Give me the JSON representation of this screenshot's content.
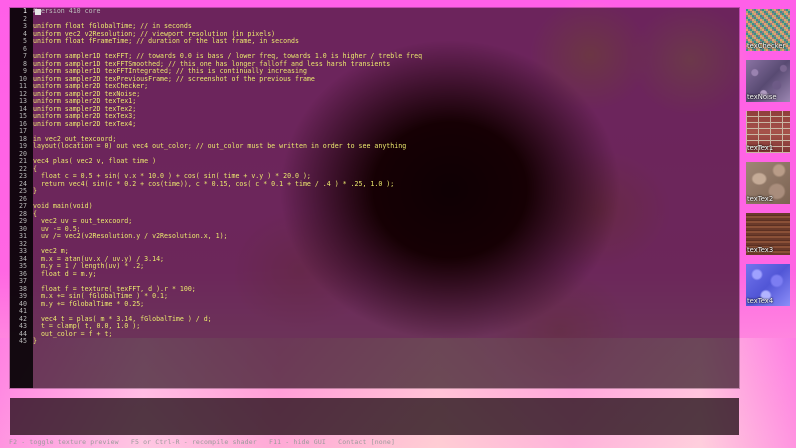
{
  "editor": {
    "lines": [
      {
        "num": "1",
        "text": "#version 410 core"
      },
      {
        "num": "2",
        "text": ""
      },
      {
        "num": "3",
        "text": "uniform float fGlobalTime; // in seconds"
      },
      {
        "num": "4",
        "text": "uniform vec2 v2Resolution; // viewport resolution (in pixels)"
      },
      {
        "num": "5",
        "text": "uniform float fFrameTime; // duration of the last frame, in seconds"
      },
      {
        "num": "6",
        "text": ""
      },
      {
        "num": "7",
        "text": "uniform sampler1D texFFT; // towards 0.0 is bass / lower freq, towards 1.0 is higher / treble freq"
      },
      {
        "num": "8",
        "text": "uniform sampler1D texFFTSmoothed; // this one has longer falloff and less harsh transients"
      },
      {
        "num": "9",
        "text": "uniform sampler1D texFFTIntegrated; // this is continually increasing"
      },
      {
        "num": "10",
        "text": "uniform sampler2D texPreviousFrame; // screenshot of the previous frame"
      },
      {
        "num": "11",
        "text": "uniform sampler2D texChecker;"
      },
      {
        "num": "12",
        "text": "uniform sampler2D texNoise;"
      },
      {
        "num": "13",
        "text": "uniform sampler2D texTex1;"
      },
      {
        "num": "14",
        "text": "uniform sampler2D texTex2;"
      },
      {
        "num": "15",
        "text": "uniform sampler2D texTex3;"
      },
      {
        "num": "16",
        "text": "uniform sampler2D texTex4;"
      },
      {
        "num": "17",
        "text": ""
      },
      {
        "num": "18",
        "text": "in vec2 out_texcoord;"
      },
      {
        "num": "19",
        "text": "layout(location = 0) out vec4 out_color; // out_color must be written in order to see anything"
      },
      {
        "num": "20",
        "text": ""
      },
      {
        "num": "21",
        "text": "vec4 plas( vec2 v, float time )"
      },
      {
        "num": "22",
        "text": "{"
      },
      {
        "num": "23",
        "text": "  float c = 0.5 + sin( v.x * 10.0 ) + cos( sin( time + v.y ) * 20.0 );"
      },
      {
        "num": "24",
        "text": "  return vec4( sin(c * 0.2 + cos(time)), c * 0.15, cos( c * 0.1 + time / .4 ) * .25, 1.0 );"
      },
      {
        "num": "25",
        "text": "}"
      },
      {
        "num": "26",
        "text": ""
      },
      {
        "num": "27",
        "text": "void main(void)"
      },
      {
        "num": "28",
        "text": "{"
      },
      {
        "num": "29",
        "text": "  vec2 uv = out_texcoord;"
      },
      {
        "num": "30",
        "text": "  uv -= 0.5;"
      },
      {
        "num": "31",
        "text": "  uv /= vec2(v2Resolution.y / v2Resolution.x, 1);"
      },
      {
        "num": "32",
        "text": ""
      },
      {
        "num": "33",
        "text": "  vec2 m;"
      },
      {
        "num": "34",
        "text": "  m.x = atan(uv.x / uv.y) / 3.14;"
      },
      {
        "num": "35",
        "text": "  m.y = 1 / length(uv) * .2;"
      },
      {
        "num": "36",
        "text": "  float d = m.y;"
      },
      {
        "num": "37",
        "text": ""
      },
      {
        "num": "38",
        "text": "  float f = texture( texFFT, d ).r * 100;"
      },
      {
        "num": "39",
        "text": "  m.x += sin( fGlobalTime ) * 0.1;"
      },
      {
        "num": "40",
        "text": "  m.y += fGlobalTime * 0.25;"
      },
      {
        "num": "41",
        "text": ""
      },
      {
        "num": "42",
        "text": "  vec4 t = plas( m * 3.14, fGlobalTime ) / d;"
      },
      {
        "num": "43",
        "text": "  t = clamp( t, 0.0, 1.0 );"
      },
      {
        "num": "44",
        "text": "  out_color = f + t;"
      },
      {
        "num": "45",
        "text": "}"
      }
    ]
  },
  "textures": [
    {
      "label": "texChecker",
      "style": "checker"
    },
    {
      "label": "texNoise",
      "style": "noise"
    },
    {
      "label": "texTex1",
      "style": "brick"
    },
    {
      "label": "texTex2",
      "style": "stone"
    },
    {
      "label": "texTex3",
      "style": "wood"
    },
    {
      "label": "texTex4",
      "style": "normal"
    }
  ],
  "statusbar": {
    "text": "F2 - toggle texture preview   F5 or Ctrl-R - recompile shader   F11 - hide GUI   Contact [none]"
  },
  "colors": {
    "code_text": "#ecea6e",
    "line_numbers": "#b9b9b9",
    "background_glow": "#ff66e3"
  }
}
